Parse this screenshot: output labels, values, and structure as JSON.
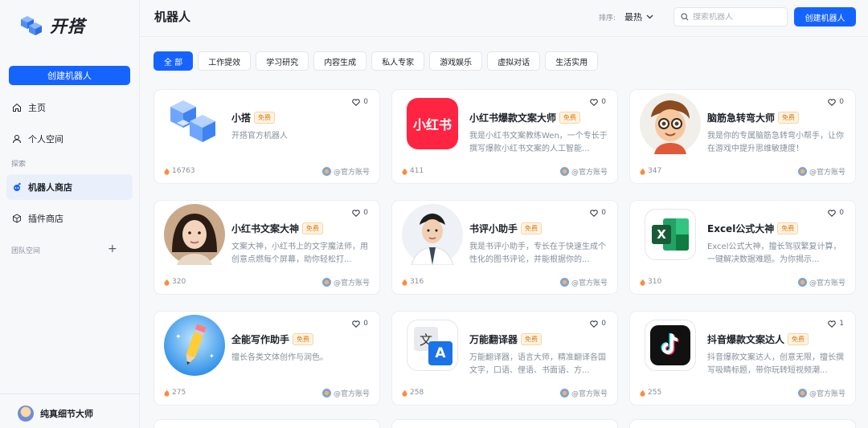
{
  "brand": {
    "name": "开搭"
  },
  "sidebar": {
    "create_label": "创建机器人",
    "items": [
      {
        "label": "主页",
        "icon": "home-icon"
      },
      {
        "label": "个人空间",
        "icon": "user-icon"
      },
      {
        "label": "机器人商店",
        "icon": "robot-icon"
      },
      {
        "label": "插件商店",
        "icon": "cube-icon"
      }
    ],
    "section_explore": "探索",
    "section_team": "团队空间",
    "team_add": "+",
    "user_name": "纯真细节大师"
  },
  "header": {
    "title": "机器人",
    "sort_label": "排序:",
    "sort_value": "最热",
    "search_placeholder": "搜索机器人",
    "create_label": "创建机器人"
  },
  "tabs": [
    "全 部",
    "工作提效",
    "学习研究",
    "内容生成",
    "私人专家",
    "游戏娱乐",
    "虚拟对话",
    "生活实用"
  ],
  "cards": [
    {
      "name": "小搭",
      "badge": "免费",
      "desc": "开搭官方机器人",
      "likes": "0",
      "heat": "16763",
      "owner": "@官方账号",
      "icon": "cube-logo-icon"
    },
    {
      "name": "小红书爆款文案大师",
      "badge": "免费",
      "desc": "我是小红书文案教练Wen，一个专长于撰写爆款小红书文案的人工智能...",
      "likes": "0",
      "heat": "411",
      "owner": "@官方账号",
      "icon": "xiaohongshu-icon",
      "icon_text": "小红书"
    },
    {
      "name": "脑筋急转弯大师",
      "badge": "免费",
      "desc": "我是你的专属脑筋急转弯小帮手，让你在游戏中提升思维敏捷度！",
      "likes": "0",
      "heat": "347",
      "owner": "@官方账号",
      "icon": "cartoon-boy-avatar"
    },
    {
      "name": "小红书文案大神",
      "badge": "免费",
      "desc": "文案大神，小红书上的文字魔法师，用创意点燃每个屏幕，助你轻松打...",
      "likes": "0",
      "heat": "320",
      "owner": "@官方账号",
      "icon": "woman-portrait-avatar"
    },
    {
      "name": "书评小助手",
      "badge": "免费",
      "desc": "我是书评小助手，专长在于快速生成个性化的图书评论，并能根据你的...",
      "likes": "0",
      "heat": "316",
      "owner": "@官方账号",
      "icon": "man-portrait-avatar"
    },
    {
      "name": "Excel公式大神",
      "badge": "免费",
      "desc": "Excel公式大神，擅长驾驭繁复计算，一键解决数据难题。为你揭示...",
      "likes": "0",
      "heat": "310",
      "owner": "@官方账号",
      "icon": "excel-icon",
      "icon_text": "X"
    },
    {
      "name": "全能写作助手",
      "badge": "免费",
      "desc": "擅长各类文体创作与润色。",
      "likes": "0",
      "heat": "275",
      "owner": "@官方账号",
      "icon": "pencil-icon"
    },
    {
      "name": "万能翻译器",
      "badge": "免费",
      "desc": "万能翻译器，语言大师，精准翻译各国文字，口语、俚语、书面语、方...",
      "likes": "0",
      "heat": "258",
      "owner": "@官方账号",
      "icon": "translate-icon",
      "icon_text_a": "文",
      "icon_text_b": "A"
    },
    {
      "name": "抖音爆款文案达人",
      "badge": "免费",
      "desc": "抖音爆款文案达人，创意无限，擅长撰写吸睛标题，带你玩转短视频潮...",
      "likes": "1",
      "heat": "255",
      "owner": "@官方账号",
      "icon": "tiktok-icon"
    }
  ],
  "colors": {
    "primary": "#1664ff",
    "badge": "#d97a14"
  }
}
